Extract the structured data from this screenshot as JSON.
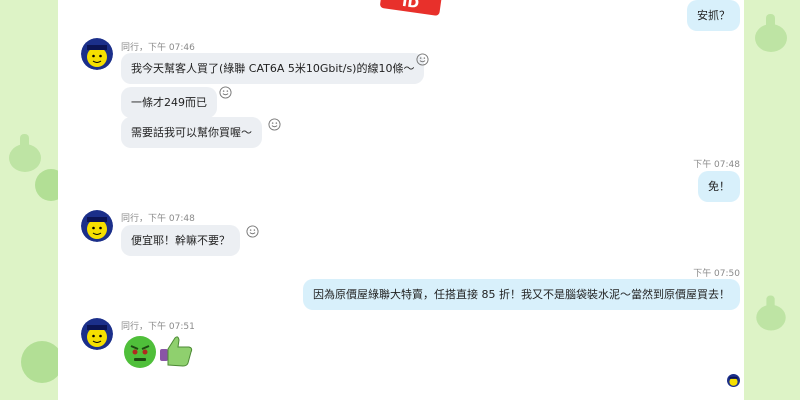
{
  "colors": {
    "background": "#ddf3c6",
    "incoming_bubble": "#eceff3",
    "outgoing_bubble": "#d8f0fb"
  },
  "banner_text": "ID",
  "messages": [
    {
      "direction": "out",
      "text": "安抓？"
    },
    {
      "direction": "in",
      "sender": "同行",
      "time": "下午 07:46",
      "texts": [
        "我今天幫客人買了(綠聯 CAT6A 5米10Gbit/s)的線10條～",
        "一條才249而已",
        "需要話我可以幫你買喔～"
      ]
    },
    {
      "direction": "out",
      "time": "下午 07:48",
      "text": "免！"
    },
    {
      "direction": "in",
      "sender": "同行",
      "time": "下午 07:48",
      "texts": [
        "便宜耶！幹嘛不要？"
      ]
    },
    {
      "direction": "out",
      "time": "下午 07:50",
      "text": "因為原價屋綠聯大特賣，任搭直接 85 折！我又不是腦袋裝水泥～當然到原價屋買去！"
    },
    {
      "direction": "in",
      "sender": "同行",
      "time": "下午 07:51",
      "stickers": [
        "angry-face-sticker",
        "thumbs-up-sticker"
      ]
    }
  ]
}
